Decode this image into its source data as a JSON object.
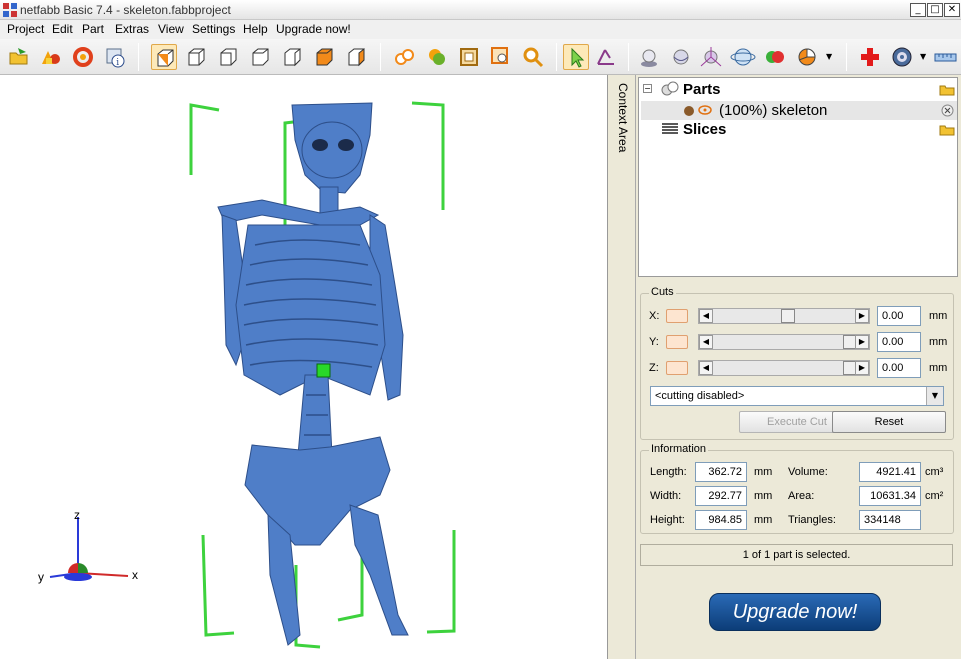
{
  "window": {
    "title": "netfabb Basic 7.4 - skeleton.fabbproject",
    "icon": "app-grid-icon",
    "controls": [
      "minimize",
      "maximize",
      "close"
    ]
  },
  "menu": [
    "Project",
    "Edit",
    "Part",
    "Extras",
    "View",
    "Settings",
    "Help",
    "Upgrade now!"
  ],
  "toolbar": {
    "buttons": [
      "open-project-icon",
      "add-part-icon",
      "repair-icon",
      "part-info-icon",
      "view-standard-icon",
      "view-front-icon",
      "view-back-icon",
      "view-left-icon",
      "view-right-icon",
      "view-top-icon",
      "view-bottom-icon",
      "spheres-icon",
      "shaded-sphere-icon",
      "frame-icon",
      "zoom-to-frame-icon",
      "zoom-icon",
      "select-pointer-icon",
      "measure-icon",
      "shadow-sphere-icon",
      "translucent-sphere-icon",
      "axes-sphere-icon",
      "globe-icon",
      "color-spheres-icon",
      "pie-chart-icon",
      "red-cross-icon",
      "disk-icon",
      "ruler-icon"
    ],
    "selected": "view-standard-icon"
  },
  "context_tab": {
    "label": "Context Area"
  },
  "tree": {
    "parts_label": "Parts",
    "part_label": "(100%) skeleton",
    "slices_label": "Slices"
  },
  "cuts": {
    "title": "Cuts",
    "axes": [
      {
        "label": "X:",
        "value": "0.00",
        "unit": "mm",
        "position": 0.52
      },
      {
        "label": "Y:",
        "value": "0.00",
        "unit": "mm",
        "position": 1.0
      },
      {
        "label": "Z:",
        "value": "0.00",
        "unit": "mm",
        "position": 1.0
      }
    ],
    "mode": "<cutting disabled>",
    "execute_label": "Execute Cut",
    "reset_label": "Reset"
  },
  "information": {
    "title": "Information",
    "length_label": "Length:",
    "length": "362.72",
    "length_unit": "mm",
    "width_label": "Width:",
    "width": "292.77",
    "width_unit": "mm",
    "height_label": "Height:",
    "height": "984.85",
    "height_unit": "mm",
    "volume_label": "Volume:",
    "volume": "4921.41",
    "volume_unit": "cm³",
    "area_label": "Area:",
    "area": "10631.34",
    "area_unit": "cm²",
    "triangles_label": "Triangles:",
    "triangles": "334148"
  },
  "status": "1 of 1 part is selected.",
  "upgrade_label": "Upgrade now!",
  "axes_gizmo": {
    "x": "x",
    "y": "y",
    "z": "z"
  },
  "colors": {
    "bone": "#4f7ec8",
    "bbox": "#3dd23d",
    "upgrade": "#0f4585"
  }
}
